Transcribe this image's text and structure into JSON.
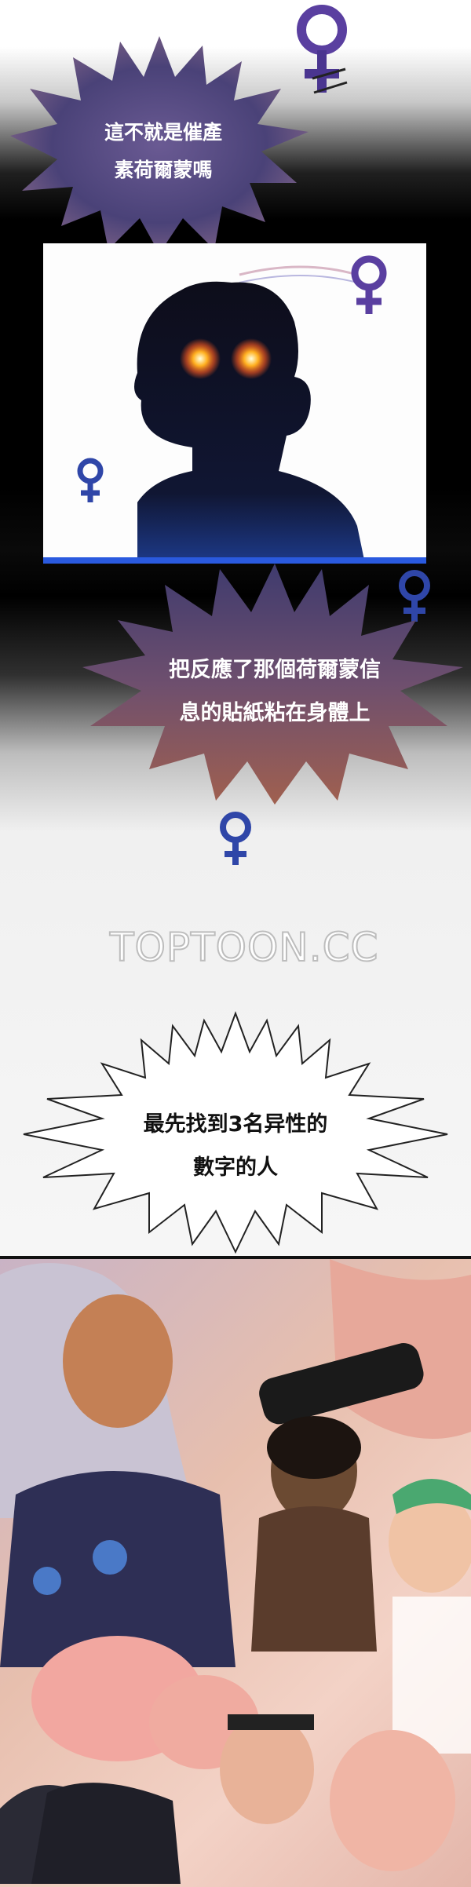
{
  "speech_bubbles": [
    {
      "lines": [
        "這不就是催產",
        "素荷爾蒙嗎"
      ]
    },
    {
      "lines": [
        "把反應了那個荷爾蒙信",
        "息的貼紙粘在身體上"
      ]
    },
    {
      "lines": [
        "最先找到3名异性的",
        "數字的人"
      ]
    }
  ],
  "watermark": "TOPTOON.CC",
  "icons": {
    "symbol_1": "female-symbol-icon",
    "symbol_2": "female-symbol-icon",
    "symbol_3": "female-symbol-icon",
    "symbol_4": "female-symbol-icon",
    "symbol_5": "female-symbol-icon"
  },
  "colors": {
    "bubble_purple": "#3f3b6e",
    "bubble_brown": "#8a5652",
    "symbol_blue": "#2f46a8",
    "symbol_purple": "#5a3fa0"
  }
}
